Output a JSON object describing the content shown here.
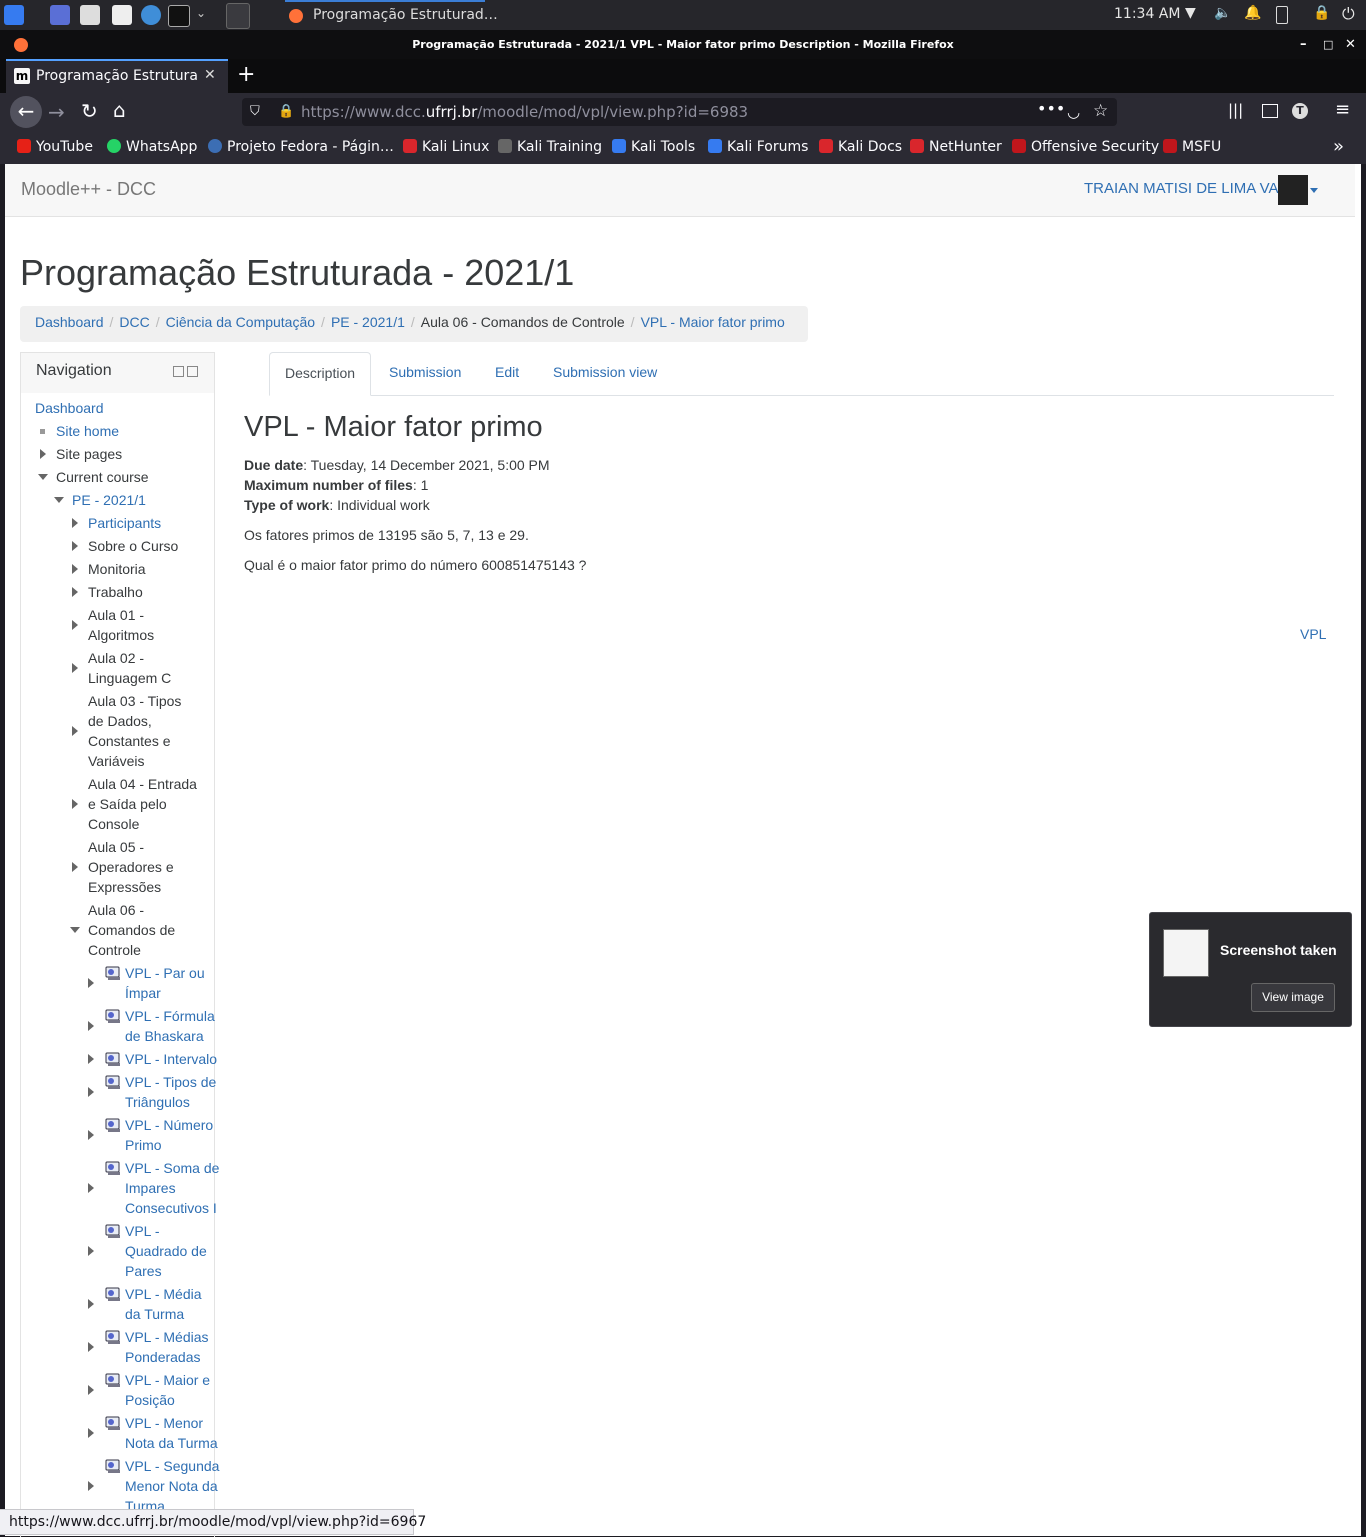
{
  "taskbar": {
    "clock": "11:34 AM",
    "task_title": "Programação Estruturad…"
  },
  "window": {
    "title": "Programação Estruturada - 2021/1 VPL - Maior fator primo Description - Mozilla Firefox"
  },
  "browser": {
    "tab_title": "Programação Estruturada",
    "url_prefix": "https://www.dcc.",
    "url_domain": "ufrrj.br",
    "url_path": "/moodle/mod/vpl/view.php?id=6983",
    "bookmarks": [
      {
        "label": "YouTube",
        "color": "#e62117"
      },
      {
        "label": "WhatsApp",
        "color": "#25d366"
      },
      {
        "label": "Projeto Fedora - Págin…",
        "color": "#3c6eb4"
      },
      {
        "label": "Kali Linux",
        "color": "#d9262c"
      },
      {
        "label": "Kali Training",
        "color": "#888888"
      },
      {
        "label": "Kali Tools",
        "color": "#367bf0"
      },
      {
        "label": "Kali Forums",
        "color": "#367bf0"
      },
      {
        "label": "Kali Docs",
        "color": "#d9262c"
      },
      {
        "label": "NetHunter",
        "color": "#d9262c"
      },
      {
        "label": "Offensive Security",
        "color": "#c0161c"
      },
      {
        "label": "MSFU",
        "color": "#c0161c"
      }
    ]
  },
  "site": {
    "brand": "Moodle++ - DCC",
    "user_name": "TRAIAN MATISI DE LIMA VAZ"
  },
  "course": {
    "title": "Programação Estruturada - 2021/1",
    "breadcrumb": [
      "Dashboard",
      "DCC",
      "Ciência da Computação",
      "PE - 2021/1",
      "Aula 06 - Comandos de Controle",
      "VPL - Maior fator primo"
    ]
  },
  "navigation": {
    "title": "Navigation",
    "dashboard": "Dashboard",
    "site_home": "Site home",
    "site_pages": "Site pages",
    "current_course": "Current course",
    "course_short": "PE - 2021/1",
    "participants": "Participants",
    "sections": [
      [
        "Sobre o Curso"
      ],
      [
        "Monitoria"
      ],
      [
        "Trabalho"
      ],
      [
        "Aula 01 -",
        "Algoritmos"
      ],
      [
        "Aula 02 -",
        "Linguagem C"
      ],
      [
        "Aula 03 - Tipos",
        "de Dados,",
        "Constantes e",
        "Variáveis"
      ],
      [
        "Aula 04 - Entrada",
        "e Saída pelo",
        "Console"
      ],
      [
        "Aula 05 -",
        "Operadores e",
        "Expressões"
      ],
      [
        "Aula 06 -",
        "Comandos de",
        "Controle"
      ]
    ],
    "activities": [
      [
        "VPL - Par ou",
        "Ímpar"
      ],
      [
        "VPL - Fórmula",
        "de Bhaskara"
      ],
      [
        "VPL - Intervalo"
      ],
      [
        "VPL - Tipos de",
        "Triângulos"
      ],
      [
        "VPL - Número",
        "Primo"
      ],
      [
        "VPL - Soma de",
        "Impares",
        "Consecutivos I"
      ],
      [
        "VPL -",
        "Quadrado de",
        "Pares"
      ],
      [
        "VPL - Média",
        "da Turma"
      ],
      [
        "VPL - Médias",
        "Ponderadas"
      ],
      [
        "VPL - Maior e",
        "Posição"
      ],
      [
        "VPL - Menor",
        "Nota da Turma"
      ],
      [
        "VPL - Segunda",
        "Menor Nota da",
        "Turma"
      ]
    ]
  },
  "tabs": [
    "Description",
    "Submission",
    "Edit",
    "Submission view"
  ],
  "activity": {
    "title": "VPL - Maior fator primo",
    "due_label": "Due date",
    "due_value": ": Tuesday, 14 December 2021, 5:00 PM",
    "maxfiles_label": "Maximum number of files",
    "maxfiles_value": ": 1",
    "type_label": "Type of work",
    "type_value": ": Individual work",
    "para1": "Os fatores primos de 13195 são 5, 7, 13 e 29.",
    "para2": "Qual é o maior fator primo do número 600851475143 ?",
    "footer_link": "VPL"
  },
  "toast": {
    "title": "Screenshot taken",
    "button": "View image"
  },
  "status_url": "https://www.dcc.ufrrj.br/moodle/mod/vpl/view.php?id=6967"
}
